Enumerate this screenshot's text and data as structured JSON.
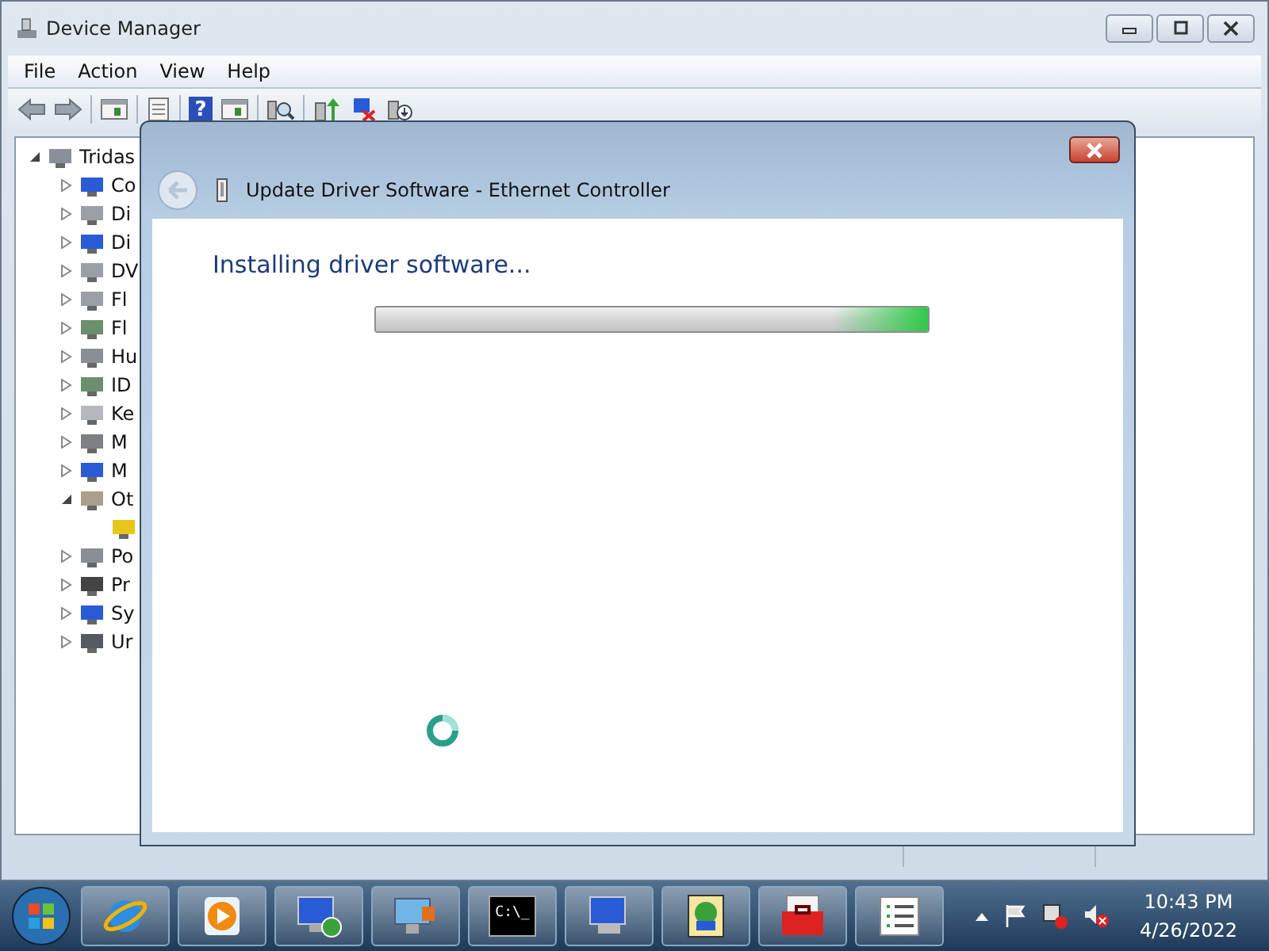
{
  "window": {
    "title": "Device Manager"
  },
  "menu": [
    "File",
    "Action",
    "View",
    "Help"
  ],
  "toolbar": [
    {
      "kind": "back"
    },
    {
      "kind": "forward"
    },
    {
      "kind": "sep"
    },
    {
      "kind": "pane"
    },
    {
      "kind": "sep"
    },
    {
      "kind": "props"
    },
    {
      "kind": "sep"
    },
    {
      "kind": "help",
      "glyph": "?"
    },
    {
      "kind": "pane2"
    },
    {
      "kind": "sep"
    },
    {
      "kind": "scan"
    },
    {
      "kind": "sep"
    },
    {
      "kind": "update"
    },
    {
      "kind": "uninstall"
    },
    {
      "kind": "disable"
    }
  ],
  "tree": [
    {
      "label": "Tridas",
      "expanded": true,
      "children": [
        {
          "label": "Co",
          "expanded": false,
          "color": "#2a5bd7"
        },
        {
          "label": "Di",
          "expanded": false,
          "color": "#9aa0a6"
        },
        {
          "label": "Di",
          "expanded": false,
          "color": "#2a5bd7"
        },
        {
          "label": "DV",
          "expanded": false,
          "color": "#9aa0a6"
        },
        {
          "label": "Fl",
          "expanded": false,
          "color": "#9aa0a6"
        },
        {
          "label": "Fl",
          "expanded": false,
          "color": "#6b8e6b"
        },
        {
          "label": "Hu",
          "expanded": false,
          "color": "#8a8f96"
        },
        {
          "label": "ID",
          "expanded": false,
          "color": "#6b8e6b"
        },
        {
          "label": "Ke",
          "expanded": false,
          "color": "#b5b8bc"
        },
        {
          "label": "M",
          "expanded": false,
          "color": "#7d8085"
        },
        {
          "label": "M",
          "expanded": false,
          "color": "#2a5bd7"
        },
        {
          "label": "Ot",
          "expanded": true,
          "color": "#a8a08a",
          "children": [
            {
              "color": "#e6c619"
            }
          ]
        },
        {
          "label": "Po",
          "expanded": false,
          "color": "#8a8f96"
        },
        {
          "label": "Pr",
          "expanded": false,
          "color": "#444444"
        },
        {
          "label": "Sy",
          "expanded": false,
          "color": "#2a5bd7"
        },
        {
          "label": "Ur",
          "expanded": false,
          "color": "#555a60"
        }
      ]
    }
  ],
  "dialog": {
    "title": "Update Driver Software - Ethernet Controller",
    "heading": "Installing driver software...",
    "progress": {
      "level": 1
    }
  },
  "taskbar": [
    {
      "kind": "ie"
    },
    {
      "kind": "media"
    },
    {
      "kind": "remote"
    },
    {
      "kind": "monitor"
    },
    {
      "kind": "cmd",
      "glyph": "C:\\_"
    },
    {
      "kind": "computer"
    },
    {
      "kind": "network"
    },
    {
      "kind": "toolbox"
    },
    {
      "kind": "list"
    }
  ],
  "clock": {
    "time": "10:43 PM",
    "date": "4/26/2022"
  }
}
